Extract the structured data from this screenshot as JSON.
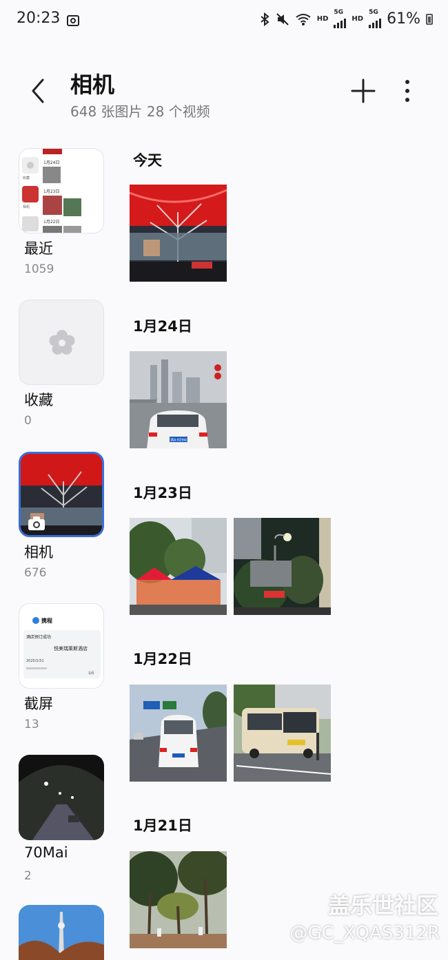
{
  "status": {
    "time": "20:23",
    "battery": "61%",
    "hd1": "HD",
    "hd2": "HD",
    "net1": "5G",
    "net2": "5G"
  },
  "header": {
    "title": "相机",
    "subtitle": "648 张图片 28 个视频"
  },
  "albums": [
    {
      "name": "最近",
      "count": "1059"
    },
    {
      "name": "收藏",
      "count": "0"
    },
    {
      "name": "相机",
      "count": "676"
    },
    {
      "name": "截屏",
      "count": "13"
    },
    {
      "name": "70Mai",
      "count": "2"
    }
  ],
  "recent_thumb": {
    "d1": "1月24日",
    "d2": "1月23日",
    "d3": "1月22日",
    "l1": "收藏",
    "l2": "相机"
  },
  "screenshot_thumb": {
    "app": "携程",
    "line1": "酒店预订成功",
    "hotel": "悦美瑞莱斯酒店",
    "date": "2025/1/31",
    "r1": "1间"
  },
  "plate_text": "浙A·K0940",
  "timeline": [
    {
      "date": "今天"
    },
    {
      "date": "1月24日"
    },
    {
      "date": "1月23日"
    },
    {
      "date": "1月22日"
    },
    {
      "date": "1月21日"
    }
  ],
  "watermark": {
    "line1": "盖乐世社区",
    "line2": "@GC_XQAS312R"
  },
  "colors": {
    "accent": "#3b6ddb",
    "background": "#fafafc"
  }
}
